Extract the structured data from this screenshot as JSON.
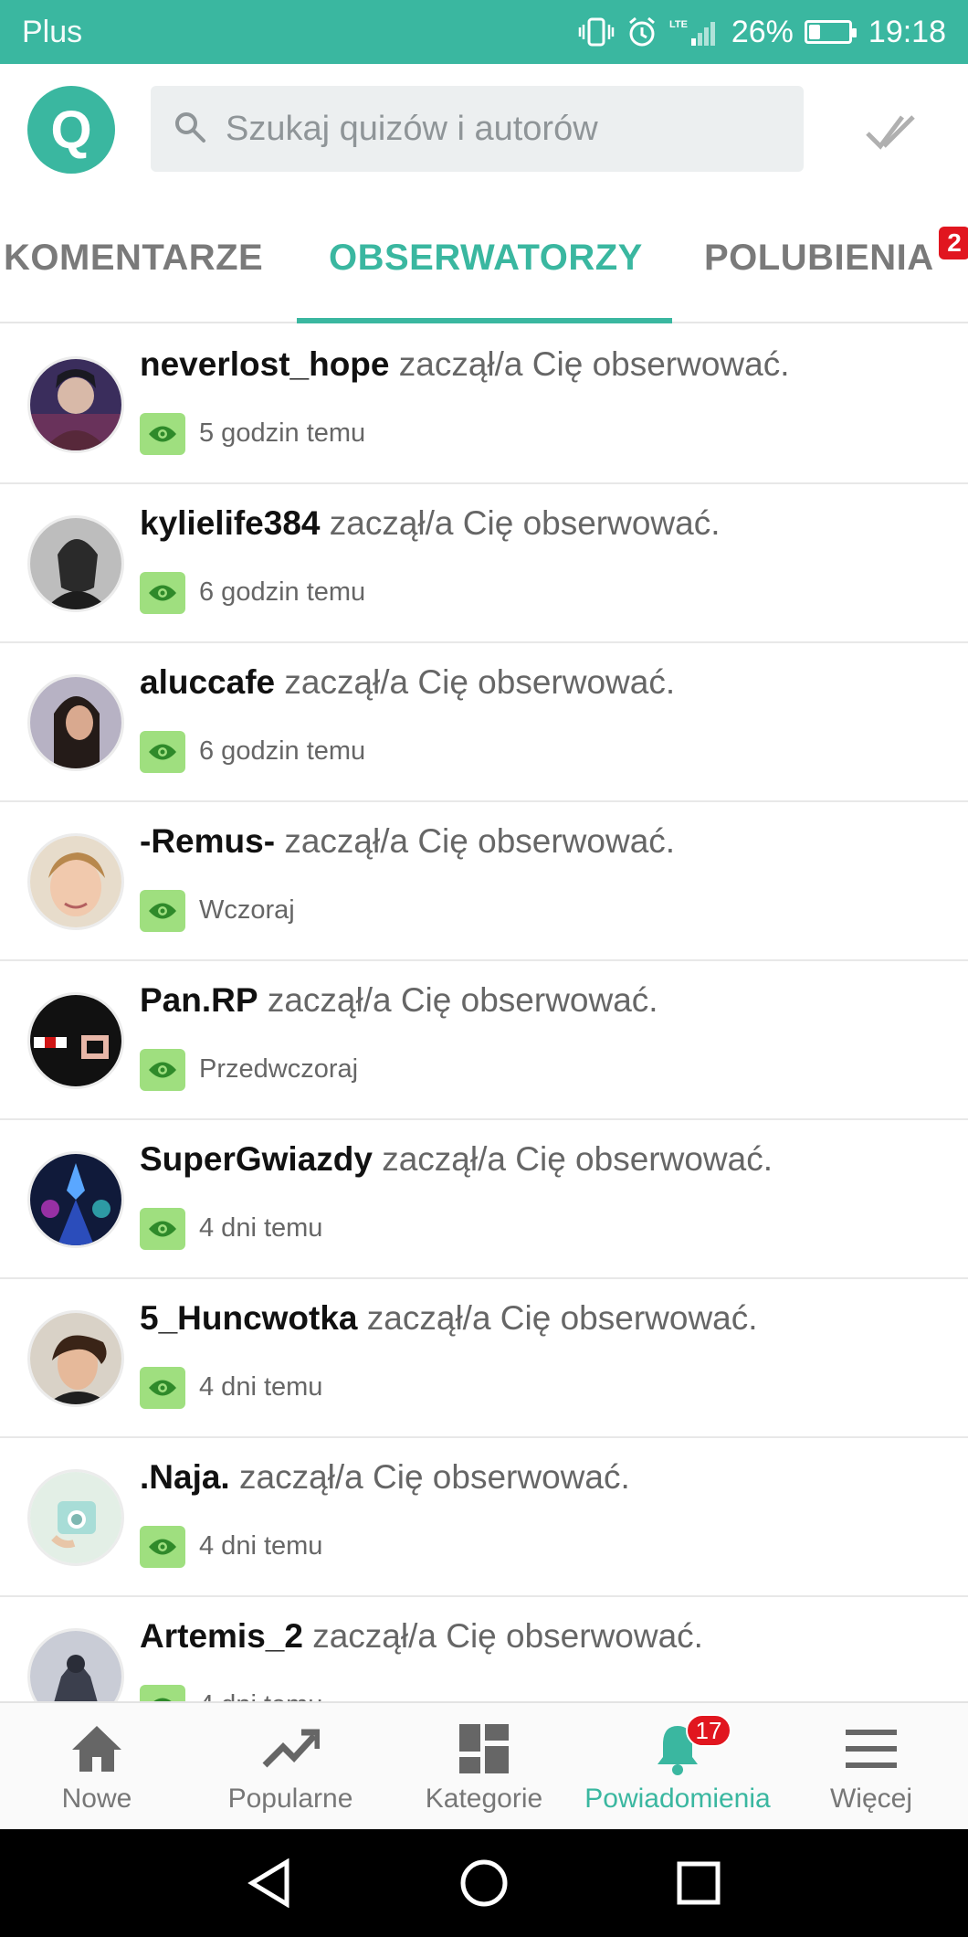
{
  "status_bar": {
    "carrier": "Plus",
    "battery": "26%",
    "battery_level": 0.26,
    "time": "19:18",
    "icons": [
      "vibrate-icon",
      "alarm-icon",
      "lte-signal-icon",
      "battery-icon"
    ]
  },
  "header": {
    "logo_letter": "Q",
    "search_placeholder": "Szukaj quizów i autorów",
    "icons": [
      "search-icon",
      "check-icon"
    ]
  },
  "tabs": [
    {
      "label": "KOMENTARZE",
      "active": false
    },
    {
      "label": "OBSERWATORZY",
      "active": true
    },
    {
      "label": "POLUBIENIA",
      "active": false,
      "badge": "2"
    }
  ],
  "notifications": [
    {
      "user": "neverlost_hope",
      "text": "zaczął/a Cię obserwować.",
      "time": "5 godzin temu"
    },
    {
      "user": "kylielife384",
      "text": "zaczął/a Cię obserwować.",
      "time": "6 godzin temu"
    },
    {
      "user": "aluccafe",
      "text": "zaczął/a Cię obserwować.",
      "time": "6 godzin temu"
    },
    {
      "user": "-Remus-",
      "text": "zaczął/a Cię obserwować.",
      "time": "Wczoraj"
    },
    {
      "user": "Pan.RP",
      "text": "zaczął/a Cię obserwować.",
      "time": "Przedwczoraj"
    },
    {
      "user": "SuperGwiazdy",
      "text": "zaczął/a Cię obserwować.",
      "time": "4 dni temu"
    },
    {
      "user": "5_Huncwotka",
      "text": "zaczął/a Cię obserwować.",
      "time": "4 dni temu"
    },
    {
      "user": ".Naja.",
      "text": "zaczął/a Cię obserwować.",
      "time": "4 dni temu"
    },
    {
      "user": "Artemis_2",
      "text": "zaczął/a Cię obserwować.",
      "time": "4 dni temu"
    }
  ],
  "bottom_nav": [
    {
      "label": "Nowe",
      "icon": "home-icon",
      "active": false
    },
    {
      "label": "Popularne",
      "icon": "trending-icon",
      "active": false
    },
    {
      "label": "Kategorie",
      "icon": "grid-icon",
      "active": false
    },
    {
      "label": "Powiadomienia",
      "icon": "bell-icon",
      "active": true,
      "badge": "17"
    },
    {
      "label": "Więcej",
      "icon": "menu-icon",
      "active": false
    }
  ],
  "colors": {
    "accent": "#3ab7a0",
    "badge": "#e1161f",
    "eye_badge": "#9fdf7f"
  }
}
